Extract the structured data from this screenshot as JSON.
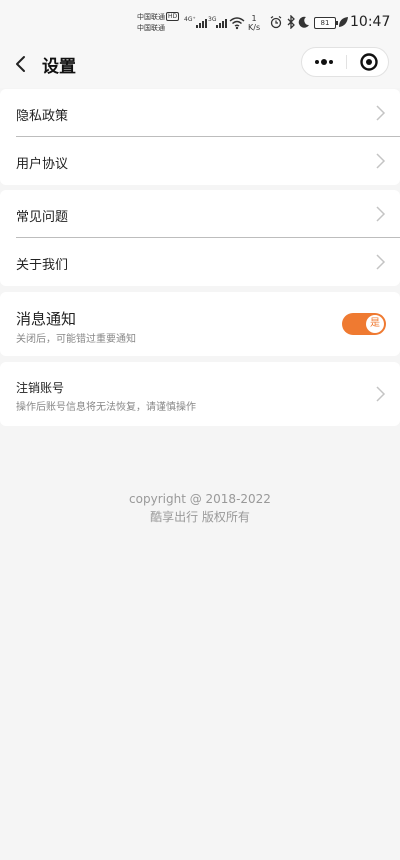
{
  "status_bar": {
    "carrier_1": "中国联通",
    "carrier_2": "中国联通",
    "hd_badge": "HD",
    "signal_1_type": "4G⁺",
    "signal_2_type": "3G",
    "net_speed_value": "1",
    "net_speed_unit": "K/s",
    "battery": "81",
    "time": "10:47"
  },
  "nav": {
    "title": "设置"
  },
  "menu": {
    "privacy": "隐私政策",
    "agreement": "用户协议",
    "faq": "常见问题",
    "about": "关于我们"
  },
  "notification": {
    "title": "消息通知",
    "subtitle": "关闭后，可能错过重要通知",
    "toggle_label": "是",
    "enabled": true
  },
  "account": {
    "title": "注销账号",
    "subtitle": "操作后账号信息将无法恢复，请谨慎操作"
  },
  "footer": {
    "copyright": "copyright @ 2018-2022",
    "company": "酷享出行 版权所有"
  },
  "colors": {
    "accent": "#ef7a31",
    "background": "#f5f5f5",
    "card": "#ffffff",
    "footer_text": "#999999"
  },
  "icons": {
    "back": "chevron-left-icon",
    "more": "more-dots-icon",
    "close": "target-circle-icon",
    "row_arrow": "chevron-right-icon"
  }
}
